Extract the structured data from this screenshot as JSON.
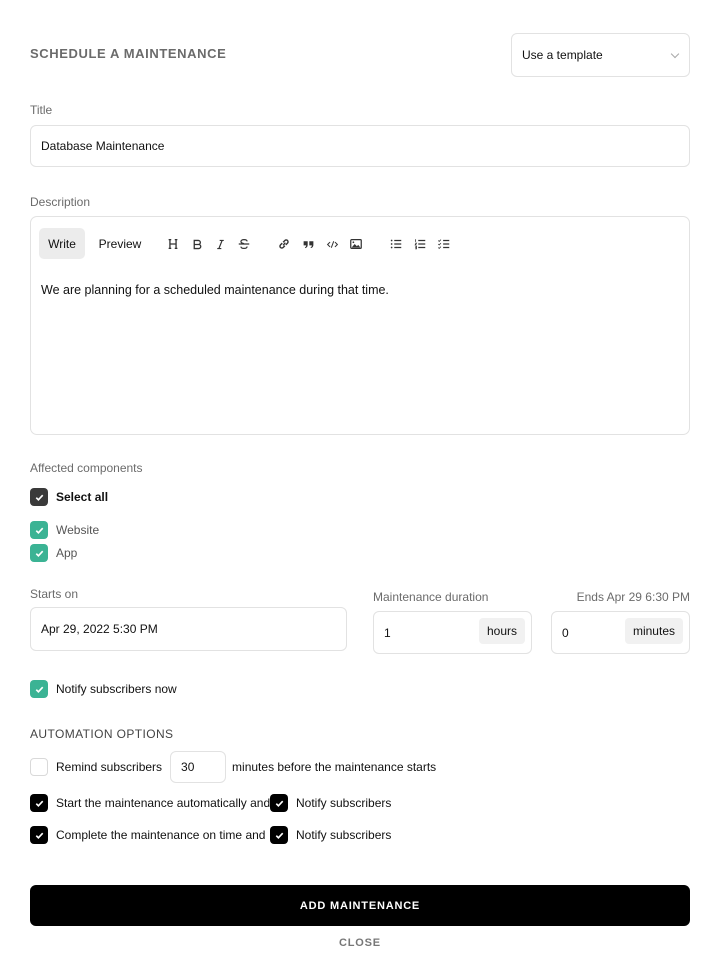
{
  "header": {
    "title": "SCHEDULE A MAINTENANCE",
    "template_select": {
      "selected": "Use a template",
      "icon": "chevron-down-icon"
    }
  },
  "title_field": {
    "label": "Title",
    "value": "Database Maintenance"
  },
  "description": {
    "label": "Description",
    "tabs": [
      {
        "label": "Write",
        "active": true
      },
      {
        "label": "Preview",
        "active": false
      }
    ],
    "toolbar": [
      {
        "name": "heading-icon",
        "glyph": "H"
      },
      {
        "name": "bold-icon",
        "glyph": "B"
      },
      {
        "name": "italic-icon",
        "glyph": "I"
      },
      {
        "name": "strikethrough-icon",
        "glyph": "S"
      },
      {
        "name": "link-icon",
        "glyph": "link"
      },
      {
        "name": "quote-icon",
        "glyph": "quote"
      },
      {
        "name": "code-icon",
        "glyph": "</>"
      },
      {
        "name": "image-icon",
        "glyph": "image"
      },
      {
        "name": "unordered-list-icon",
        "glyph": "ul"
      },
      {
        "name": "ordered-list-icon",
        "glyph": "ol"
      },
      {
        "name": "task-list-icon",
        "glyph": "tasks"
      }
    ],
    "body": "We are planning for a scheduled maintenance during that time."
  },
  "components": {
    "label": "Affected components",
    "select_all": {
      "label": "Select all",
      "checked": true
    },
    "items": [
      {
        "label": "Website",
        "checked": true
      },
      {
        "label": "App",
        "checked": true
      }
    ]
  },
  "schedule": {
    "starts_on": {
      "label": "Starts on",
      "value": "Apr 29, 2022 5:30 PM"
    },
    "duration": {
      "label": "Maintenance duration",
      "ends_text": "Ends Apr 29 6:30 PM",
      "hours": {
        "value": "1",
        "unit": "hours"
      },
      "minutes": {
        "value": "0",
        "unit": "minutes"
      }
    }
  },
  "notify_now": {
    "label": "Notify subscribers now",
    "checked": true
  },
  "automation": {
    "title": "AUTOMATION OPTIONS",
    "remind": {
      "checked": false,
      "label_before": "Remind subscribers",
      "minutes": "30",
      "label_after": "minutes before the maintenance starts"
    },
    "start_auto": {
      "checked": true,
      "label": "Start the maintenance automatically and",
      "notify": {
        "checked": true,
        "label": "Notify subscribers"
      }
    },
    "complete_auto": {
      "checked": true,
      "label": "Complete the maintenance on time and",
      "notify": {
        "checked": true,
        "label": "Notify subscribers"
      }
    }
  },
  "actions": {
    "primary": "ADD MAINTENANCE",
    "secondary": "CLOSE"
  },
  "colors": {
    "accent_green": "#3bb394",
    "primary_button": "#000000",
    "select_all_checkbox": "#3a3a3a"
  }
}
